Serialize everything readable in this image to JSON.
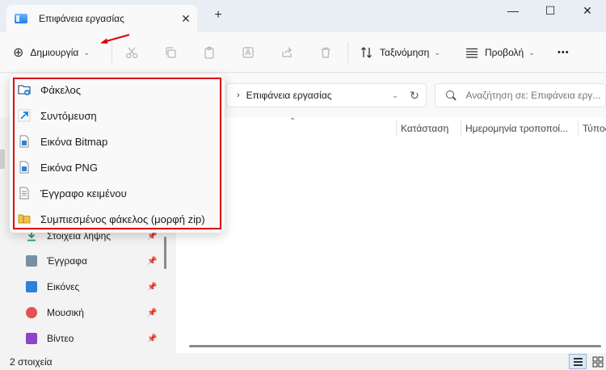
{
  "window": {
    "tab_title": "Επιφάνεια εργασίας",
    "tab_close": "✕",
    "new_tab": "+",
    "minimize": "—",
    "maximize": "☐",
    "close": "✕"
  },
  "commandbar": {
    "new_label": "Δημιουργία",
    "new_plus": "⊕",
    "sort_label": "Ταξινόμηση",
    "view_label": "Προβολή",
    "more": "•••",
    "chevron": "⌄"
  },
  "nav": {
    "address_chevron": "›",
    "address": "Επιφάνεια εργασίας",
    "address_dropdown": "⌄",
    "refresh": "↻",
    "search_placeholder": "Αναζήτηση σε: Επιφάνεια εργ..."
  },
  "columns": [
    {
      "label": "Κατάσταση"
    },
    {
      "label": "Ημερομηνία τροποποί..."
    },
    {
      "label": "Τύπος"
    }
  ],
  "sort_indicator": "⌃",
  "menu": {
    "items": [
      {
        "label": "Φάκελος",
        "icon": "new-folder-icon"
      },
      {
        "label": "Συντόμευση",
        "icon": "shortcut-icon"
      },
      {
        "label": "Εικόνα Bitmap",
        "icon": "bitmap-image-icon"
      },
      {
        "label": "Εικόνα PNG",
        "icon": "png-image-icon"
      },
      {
        "label": "Έγγραφο κειμένου",
        "icon": "text-document-icon"
      },
      {
        "label": "Συμπιεσμένος φάκελος (μορφή zip)",
        "icon": "zip-folder-icon"
      }
    ]
  },
  "sidebar": {
    "items": [
      {
        "label": "Στοιχεία λήψης",
        "icon": "downloads-icon",
        "color": "#1aa260"
      },
      {
        "label": "Έγγραφα",
        "icon": "documents-icon",
        "color": "#7a8fa6"
      },
      {
        "label": "Εικόνες",
        "icon": "pictures-icon",
        "color": "#2a83d8"
      },
      {
        "label": "Μουσική",
        "icon": "music-icon",
        "color": "#e0554f"
      },
      {
        "label": "Βίντεο",
        "icon": "videos-icon",
        "color": "#8e44c9"
      }
    ],
    "pin": "📌"
  },
  "status": {
    "count": "2 στοιχεία"
  },
  "colors": {
    "highlight_outline": "#e00000",
    "accent": "#1f7fe0"
  }
}
